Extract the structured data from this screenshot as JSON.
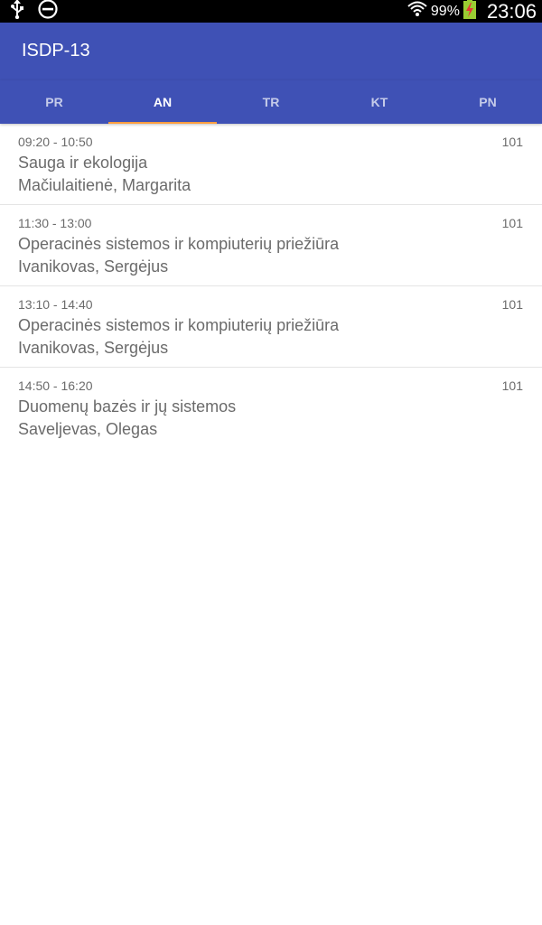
{
  "status_bar": {
    "battery_percent": "99%",
    "time": "23:06",
    "icons": [
      "usb-icon",
      "do-not-disturb-icon",
      "wifi-icon",
      "battery-charging-icon"
    ]
  },
  "app_bar": {
    "title": "ISDP-13"
  },
  "tabs": [
    {
      "label": "PR"
    },
    {
      "label": "AN"
    },
    {
      "label": "TR"
    },
    {
      "label": "KT"
    },
    {
      "label": "PN"
    }
  ],
  "active_tab": "AN",
  "colors": {
    "primary": "#3f51b5",
    "tab_indicator": "#ff9e40",
    "text_secondary": "#6b6b6b"
  },
  "lessons": [
    {
      "time": "09:20 - 10:50",
      "room": "101",
      "subject": "Sauga ir ekologija",
      "teacher": "Mačiulaitienė, Margarita"
    },
    {
      "time": "11:30 - 13:00",
      "room": "101",
      "subject": "Operacinės sistemos ir kompiuterių priežiūra",
      "teacher": "Ivanikovas, Sergėjus"
    },
    {
      "time": "13:10 - 14:40",
      "room": "101",
      "subject": "Operacinės sistemos ir kompiuterių priežiūra",
      "teacher": "Ivanikovas, Sergėjus"
    },
    {
      "time": "14:50 - 16:20",
      "room": "101",
      "subject": "Duomenų bazės ir jų sistemos",
      "teacher": "Saveljevas, Olegas"
    }
  ]
}
